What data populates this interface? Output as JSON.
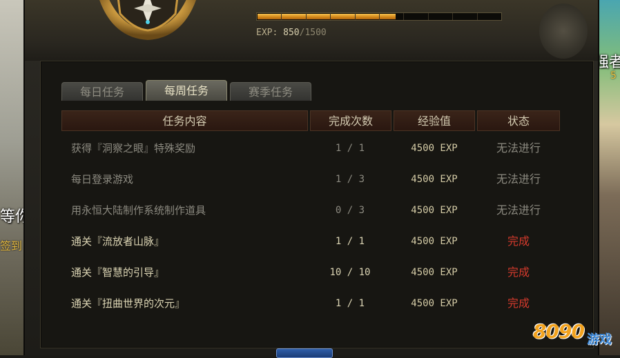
{
  "background": {
    "left_text": "等你",
    "right_text": "强者",
    "right_num": "5"
  },
  "header": {
    "exp_label": "EXP:",
    "exp_current": "850",
    "exp_max": "/1500",
    "exp_progress": 0.567,
    "exp_segments": 10
  },
  "tabs": [
    {
      "label": "每日任务",
      "active": false
    },
    {
      "label": "每周任务",
      "active": true
    },
    {
      "label": "赛季任务",
      "active": false
    }
  ],
  "table": {
    "headers": [
      "任务内容",
      "完成次数",
      "经验值",
      "状态"
    ],
    "rows": [
      {
        "name": "获得『洞察之眼』特殊奖励",
        "count": "1 / 1",
        "exp": "4500 EXP",
        "status": "无法进行",
        "done": false
      },
      {
        "name": "每日登录游戏",
        "count": "1 / 3",
        "exp": "4500 EXP",
        "status": "无法进行",
        "done": false
      },
      {
        "name": "用永恒大陆制作系统制作道具",
        "count": "0 / 3",
        "exp": "4500 EXP",
        "status": "无法进行",
        "done": false
      },
      {
        "name": "通关『流放者山脉』",
        "count": "1 / 1",
        "exp": "4500 EXP",
        "status": "完成",
        "done": true
      },
      {
        "name": "通关『智慧的引导』",
        "count": "10 / 10",
        "exp": "4500 EXP",
        "status": "完成",
        "done": true
      },
      {
        "name": "通关『扭曲世界的次元』",
        "count": "1 / 1",
        "exp": "4500 EXP",
        "status": "完成",
        "done": true
      }
    ]
  },
  "watermark": {
    "number": "8090",
    "word": "游戏"
  },
  "colors": {
    "accent": "#e8a62e",
    "done_status": "#d43a2c",
    "header_bg": "#3a2419"
  }
}
